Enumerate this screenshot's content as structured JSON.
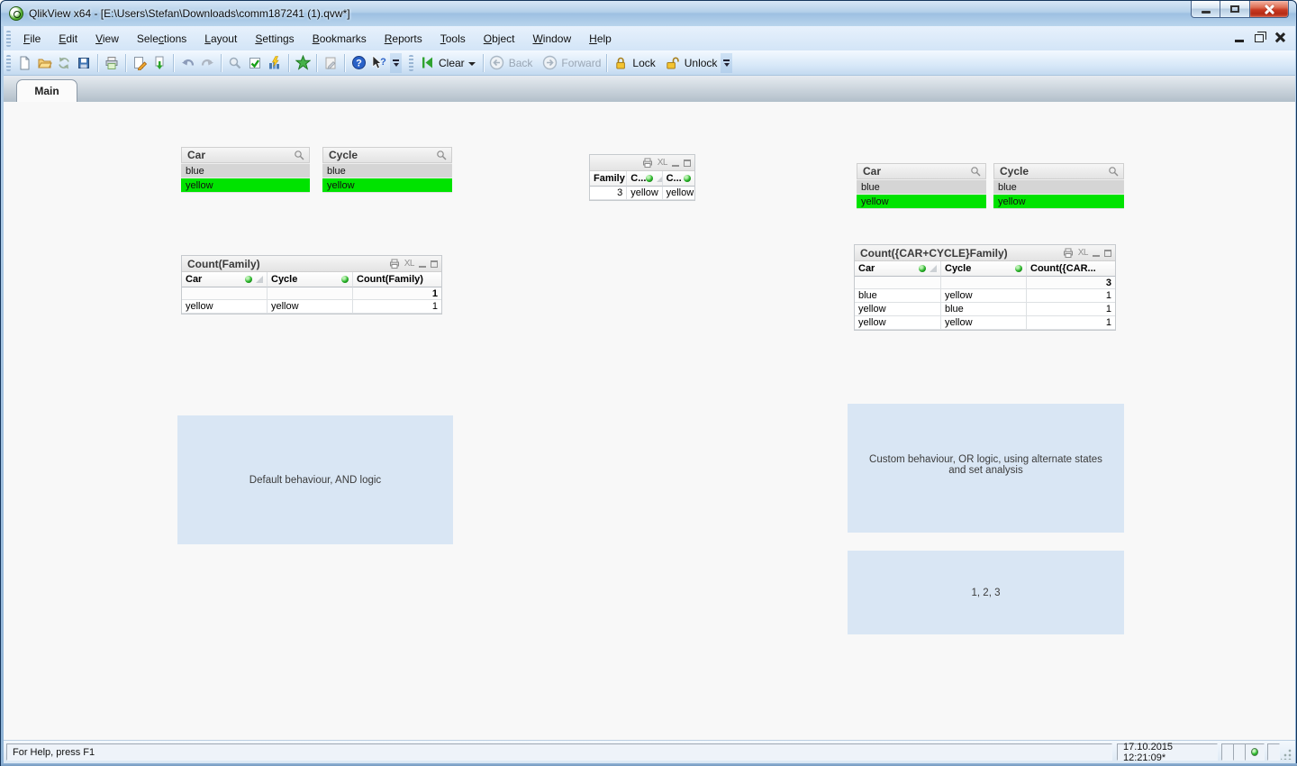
{
  "window": {
    "title": "QlikView x64 - [E:\\Users\\Stefan\\Downloads\\comm187241 (1).qvw*]"
  },
  "menu": {
    "items": [
      {
        "label": "File",
        "u": 0
      },
      {
        "label": "Edit",
        "u": 0
      },
      {
        "label": "View",
        "u": 0
      },
      {
        "label": "Selections",
        "u": 4
      },
      {
        "label": "Layout",
        "u": 0
      },
      {
        "label": "Settings",
        "u": 0
      },
      {
        "label": "Bookmarks",
        "u": 0
      },
      {
        "label": "Reports",
        "u": 0
      },
      {
        "label": "Tools",
        "u": 0
      },
      {
        "label": "Object",
        "u": 0
      },
      {
        "label": "Window",
        "u": 0
      },
      {
        "label": "Help",
        "u": 0
      }
    ]
  },
  "toolbar": {
    "clear_label": "Clear",
    "back_label": "Back",
    "forward_label": "Forward",
    "lock_label": "Lock",
    "unlock_label": "Unlock"
  },
  "tabs": [
    {
      "label": "Main"
    }
  ],
  "labels": {
    "xl": "XL"
  },
  "sheet": {
    "listboxes": [
      {
        "title": "Car",
        "items": [
          {
            "value": "blue",
            "state": "excluded"
          },
          {
            "value": "yellow",
            "state": "selected"
          }
        ]
      },
      {
        "title": "Cycle",
        "items": [
          {
            "value": "blue",
            "state": "excluded"
          },
          {
            "value": "yellow",
            "state": "selected"
          }
        ]
      },
      {
        "title": "Car",
        "items": [
          {
            "value": "blue",
            "state": "excluded"
          },
          {
            "value": "yellow",
            "state": "selected"
          }
        ]
      },
      {
        "title": "Cycle",
        "items": [
          {
            "value": "blue",
            "state": "excluded"
          },
          {
            "value": "yellow",
            "state": "selected"
          }
        ]
      }
    ],
    "family_table": {
      "columns": [
        {
          "label": "Family",
          "dot": false,
          "sort": false
        },
        {
          "label": "C...",
          "dot": true,
          "sort": true
        },
        {
          "label": "C...",
          "dot": true,
          "sort": false
        }
      ],
      "rows": [
        [
          "3",
          "yellow",
          "yellow"
        ]
      ]
    },
    "count_family_table": {
      "title": "Count(Family)",
      "columns": [
        {
          "label": "Car",
          "dot": true,
          "sort": true
        },
        {
          "label": "Cycle",
          "dot": true,
          "sort": false
        },
        {
          "label": "Count(Family)",
          "dot": false,
          "sort": false
        }
      ],
      "total": "1",
      "rows": [
        [
          "yellow",
          "yellow",
          "1"
        ]
      ]
    },
    "count_set_table": {
      "title": "Count({CAR+CYCLE}Family)",
      "columns": [
        {
          "label": "Car",
          "dot": true,
          "sort": true
        },
        {
          "label": "Cycle",
          "dot": true,
          "sort": false
        },
        {
          "label": "Count({CAR...",
          "dot": false,
          "sort": false
        }
      ],
      "total": "3",
      "rows": [
        [
          "blue",
          "yellow",
          "1"
        ],
        [
          "yellow",
          "blue",
          "1"
        ],
        [
          "yellow",
          "yellow",
          "1"
        ]
      ]
    },
    "textboxes": [
      {
        "text": "Default behaviour, AND logic"
      },
      {
        "text": "Custom behaviour, OR logic, using alternate states and set analysis"
      },
      {
        "text": "1, 2, 3"
      }
    ]
  },
  "statusbar": {
    "help_text": "For Help, press F1",
    "timestamp": "17.10.2015 12:21:09*"
  },
  "colors": {
    "selected_green": "#00e300",
    "excluded_gray": "#d5d5d5",
    "textbox_blue": "#d9e6f4",
    "titlebar_blue": "#a9c8e6",
    "close_red": "#c93a22"
  }
}
